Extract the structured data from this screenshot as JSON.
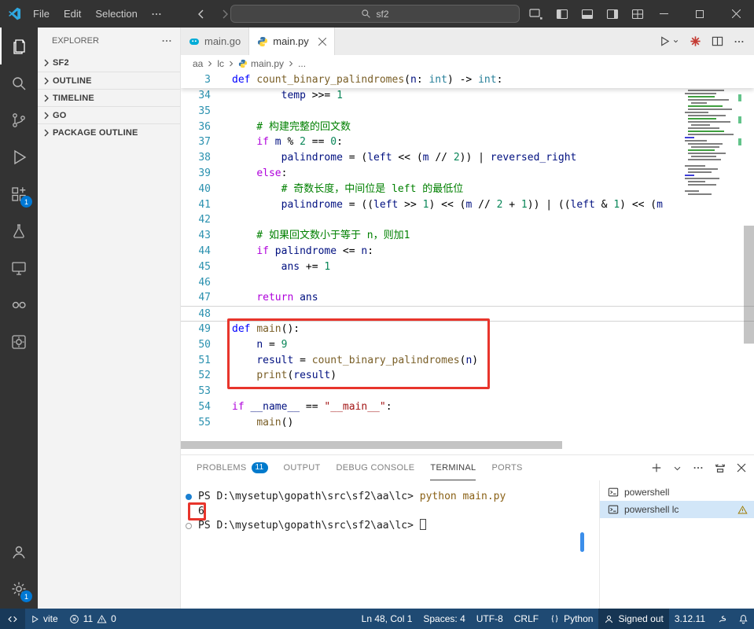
{
  "colors": {
    "accent": "#007acc",
    "annotation": "#e8352c",
    "statusbar_bg": "#1f4a73"
  },
  "titlebar": {
    "menus": [
      "File",
      "Edit",
      "Selection"
    ],
    "search": {
      "value": "sf2"
    }
  },
  "activitybar": {
    "extensions_badge": "1",
    "settings_badge": "1"
  },
  "sidebar": {
    "title": "EXPLORER",
    "sections": [
      {
        "label": "SF2"
      },
      {
        "label": "OUTLINE"
      },
      {
        "label": "TIMELINE"
      },
      {
        "label": "GO"
      },
      {
        "label": "PACKAGE OUTLINE"
      }
    ]
  },
  "editor_tabs": [
    {
      "label": "main.go"
    },
    {
      "label": "main.py"
    }
  ],
  "breadcrumbs": [
    "aa",
    "lc",
    "main.py",
    "..."
  ],
  "editor": {
    "sticky_line": {
      "num": "3",
      "tokens": [
        [
          "def",
          "k"
        ],
        [
          " ",
          "d"
        ],
        [
          "count_binary_palindromes",
          "f"
        ],
        [
          "(",
          "d"
        ],
        [
          "n",
          "v"
        ],
        [
          ": ",
          "d"
        ],
        [
          "int",
          "t"
        ],
        [
          ") -> ",
          "d"
        ],
        [
          "int",
          "t"
        ],
        [
          ":",
          "d"
        ]
      ]
    },
    "lines": [
      {
        "num": "34",
        "tokens": [
          [
            "        ",
            "d"
          ],
          [
            "temp",
            "v"
          ],
          [
            " >>= ",
            "d"
          ],
          [
            "1",
            "n"
          ]
        ]
      },
      {
        "num": "35",
        "tokens": []
      },
      {
        "num": "36",
        "tokens": [
          [
            "    # 构建完整的回文数",
            "m"
          ]
        ]
      },
      {
        "num": "37",
        "tokens": [
          [
            "    ",
            "d"
          ],
          [
            "if",
            "c"
          ],
          [
            " ",
            "d"
          ],
          [
            "m",
            "v"
          ],
          [
            " % ",
            "d"
          ],
          [
            "2",
            "n"
          ],
          [
            " == ",
            "d"
          ],
          [
            "0",
            "n"
          ],
          [
            ":",
            "d"
          ]
        ]
      },
      {
        "num": "38",
        "tokens": [
          [
            "        ",
            "d"
          ],
          [
            "palindrome",
            "v"
          ],
          [
            " = (",
            "d"
          ],
          [
            "left",
            "v"
          ],
          [
            " << (",
            "d"
          ],
          [
            "m",
            "v"
          ],
          [
            " // ",
            "d"
          ],
          [
            "2",
            "n"
          ],
          [
            ")) | ",
            "d"
          ],
          [
            "reversed_right",
            "v"
          ]
        ]
      },
      {
        "num": "39",
        "tokens": [
          [
            "    ",
            "d"
          ],
          [
            "else",
            "c"
          ],
          [
            ":",
            "d"
          ]
        ]
      },
      {
        "num": "40",
        "tokens": [
          [
            "        # 奇数长度，中间位是 left 的最低位",
            "m"
          ]
        ]
      },
      {
        "num": "41",
        "tokens": [
          [
            "        ",
            "d"
          ],
          [
            "palindrome",
            "v"
          ],
          [
            " = ((",
            "d"
          ],
          [
            "left",
            "v"
          ],
          [
            " >> ",
            "d"
          ],
          [
            "1",
            "n"
          ],
          [
            ") << (",
            "d"
          ],
          [
            "m",
            "v"
          ],
          [
            " // ",
            "d"
          ],
          [
            "2",
            "n"
          ],
          [
            " + ",
            "d"
          ],
          [
            "1",
            "n"
          ],
          [
            ")) | ((",
            "d"
          ],
          [
            "left",
            "v"
          ],
          [
            " & ",
            "d"
          ],
          [
            "1",
            "n"
          ],
          [
            ") << (",
            "d"
          ],
          [
            "m",
            "v"
          ],
          [
            " ",
            "d"
          ]
        ]
      },
      {
        "num": "42",
        "tokens": []
      },
      {
        "num": "43",
        "tokens": [
          [
            "    # 如果回文数小于等于 n，则加1",
            "m"
          ]
        ]
      },
      {
        "num": "44",
        "tokens": [
          [
            "    ",
            "d"
          ],
          [
            "if",
            "c"
          ],
          [
            " ",
            "d"
          ],
          [
            "palindrome",
            "v"
          ],
          [
            " <= ",
            "d"
          ],
          [
            "n",
            "v"
          ],
          [
            ":",
            "d"
          ]
        ]
      },
      {
        "num": "45",
        "tokens": [
          [
            "        ",
            "d"
          ],
          [
            "ans",
            "v"
          ],
          [
            " += ",
            "d"
          ],
          [
            "1",
            "n"
          ]
        ]
      },
      {
        "num": "46",
        "tokens": []
      },
      {
        "num": "47",
        "tokens": [
          [
            "    ",
            "d"
          ],
          [
            "return",
            "c"
          ],
          [
            " ",
            "d"
          ],
          [
            "ans",
            "v"
          ]
        ]
      },
      {
        "num": "48",
        "current": true,
        "tokens": []
      },
      {
        "num": "49",
        "tokens": [
          [
            "def",
            "k"
          ],
          [
            " ",
            "d"
          ],
          [
            "main",
            "f"
          ],
          [
            "():",
            "d"
          ]
        ]
      },
      {
        "num": "50",
        "tokens": [
          [
            "    ",
            "d"
          ],
          [
            "n",
            "v"
          ],
          [
            " = ",
            "d"
          ],
          [
            "9",
            "n"
          ]
        ]
      },
      {
        "num": "51",
        "tokens": [
          [
            "    ",
            "d"
          ],
          [
            "result",
            "v"
          ],
          [
            " = ",
            "d"
          ],
          [
            "count_binary_palindromes",
            "f"
          ],
          [
            "(",
            "d"
          ],
          [
            "n",
            "v"
          ],
          [
            ")",
            "d"
          ]
        ]
      },
      {
        "num": "52",
        "tokens": [
          [
            "    ",
            "d"
          ],
          [
            "print",
            "f"
          ],
          [
            "(",
            "d"
          ],
          [
            "result",
            "v"
          ],
          [
            ")",
            "d"
          ]
        ]
      },
      {
        "num": "53",
        "tokens": []
      },
      {
        "num": "54",
        "tokens": [
          [
            "if",
            "c"
          ],
          [
            " ",
            "d"
          ],
          [
            "__name__",
            "v"
          ],
          [
            " == ",
            "d"
          ],
          [
            "\"__main__\"",
            "s"
          ],
          [
            ":",
            "d"
          ]
        ]
      },
      {
        "num": "55",
        "tokens": [
          [
            "    ",
            "d"
          ],
          [
            "main",
            "f"
          ],
          [
            "()",
            "d"
          ]
        ]
      }
    ]
  },
  "panel": {
    "tabs": [
      {
        "label": "PROBLEMS",
        "badge": "11"
      },
      {
        "label": "OUTPUT"
      },
      {
        "label": "DEBUG CONSOLE"
      },
      {
        "label": "TERMINAL"
      },
      {
        "label": "PORTS"
      }
    ]
  },
  "terminal": {
    "rows": [
      {
        "decoration": "filled",
        "tokens": [
          [
            "PS D:\\mysetup\\gopath\\src\\sf2\\aa\\lc> ",
            "p"
          ],
          [
            "python main.py",
            "cmd"
          ]
        ]
      },
      {
        "decoration": "none",
        "tokens": [
          [
            "6",
            "out"
          ]
        ]
      },
      {
        "decoration": "outline",
        "cursor": true,
        "tokens": [
          [
            "PS D:\\mysetup\\gopath\\src\\sf2\\aa\\lc> ",
            "p"
          ]
        ]
      }
    ],
    "tabs": [
      {
        "label": "powershell"
      },
      {
        "label": "powershell lc",
        "selected": true,
        "warning": true
      }
    ]
  },
  "statusbar": {
    "task_label": "vite",
    "errors": "11",
    "warnings": "0",
    "line_col": "Ln 48, Col 1",
    "spaces": "Spaces: 4",
    "encoding": "UTF-8",
    "eol": "CRLF",
    "language": "Python",
    "signed": "Signed out",
    "py_version": "3.12.11"
  }
}
